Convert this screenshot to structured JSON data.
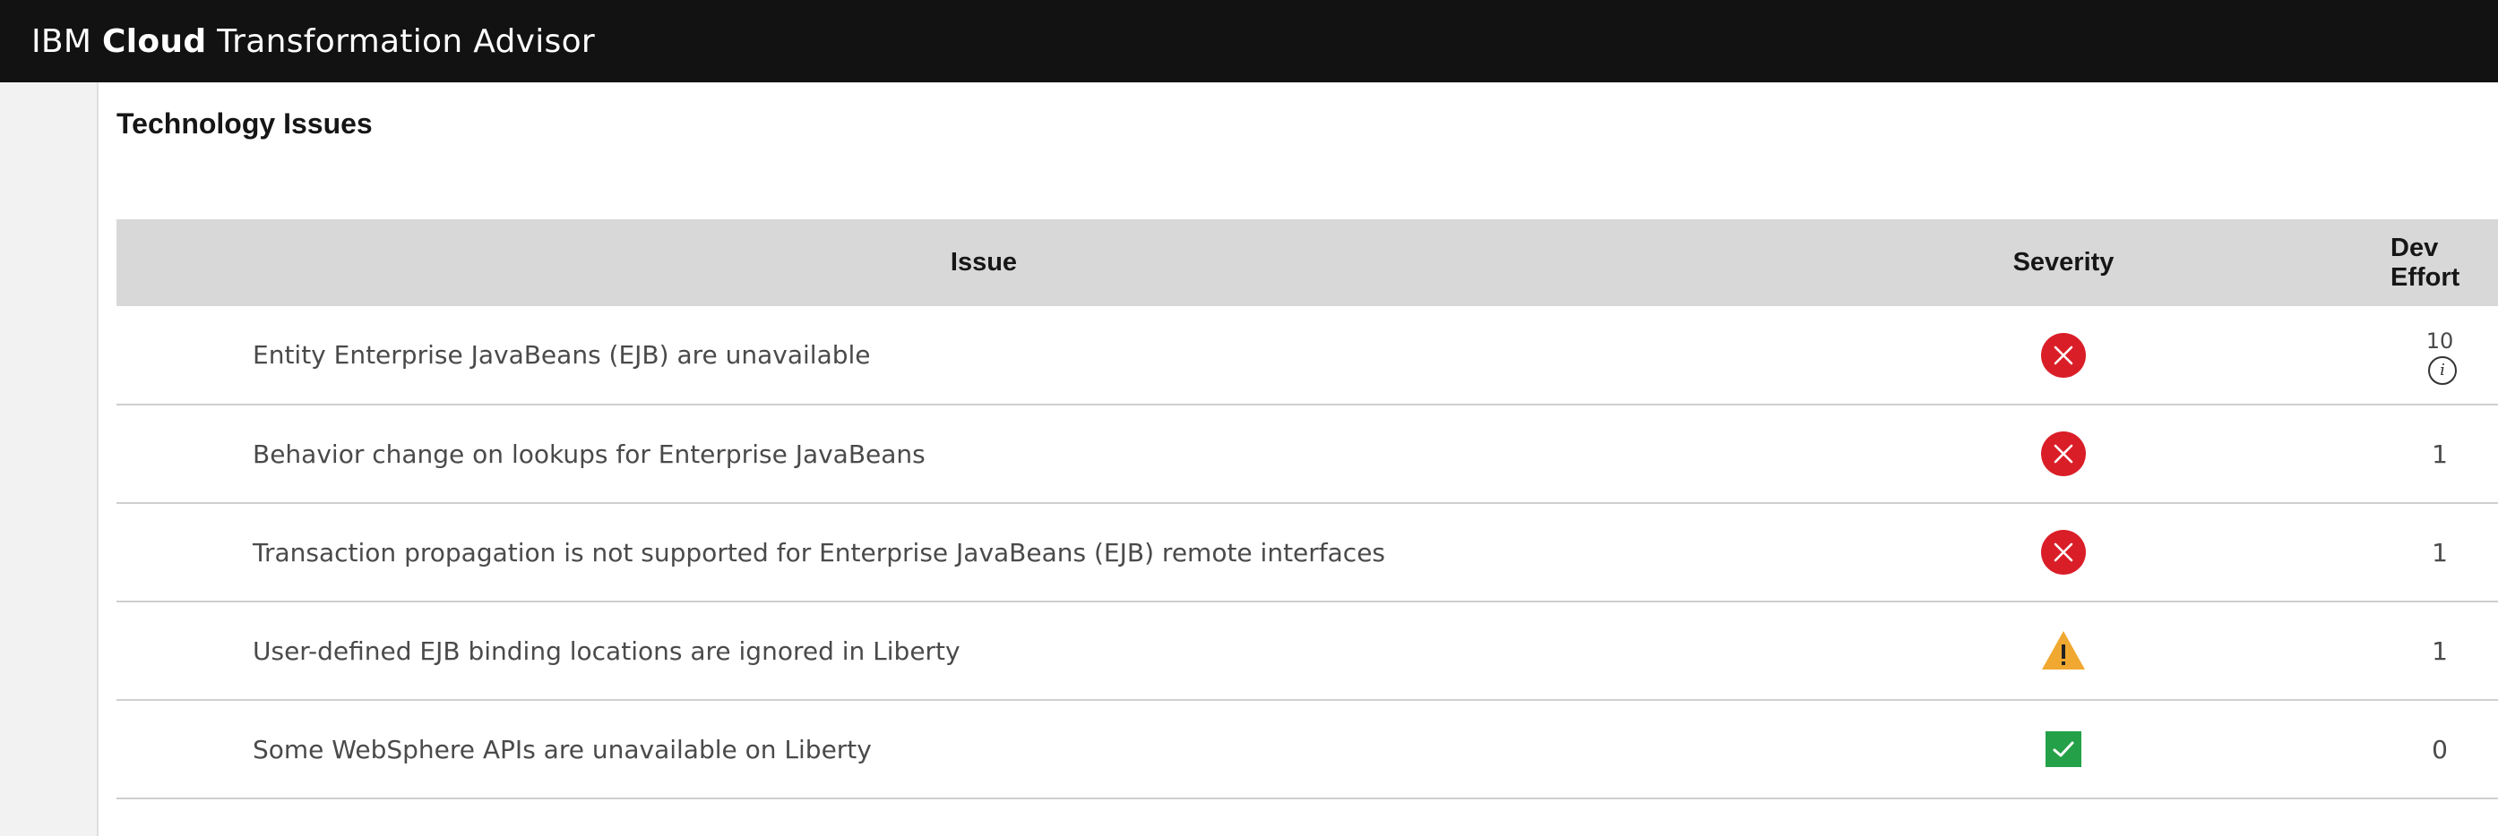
{
  "header": {
    "brand_prefix": "IBM",
    "brand_bold": "Cloud",
    "brand_suffix": "Transformation Advisor"
  },
  "page": {
    "title": "Technology Issues"
  },
  "table": {
    "columns": {
      "issue": "Issue",
      "severity": "Severity",
      "effort": "Dev Effort"
    },
    "rows": [
      {
        "issue": "Entity Enterprise JavaBeans (EJB) are unavailable",
        "severity": "critical",
        "effort": "10",
        "has_info": true
      },
      {
        "issue": "Behavior change on lookups for Enterprise JavaBeans",
        "severity": "critical",
        "effort": "1",
        "has_info": false
      },
      {
        "issue": "Transaction propagation is not supported for Enterprise JavaBeans (EJB) remote interfaces",
        "severity": "critical",
        "effort": "1",
        "has_info": false
      },
      {
        "issue": "User-defined EJB binding locations are ignored in Liberty",
        "severity": "warning",
        "effort": "1",
        "has_info": false
      },
      {
        "issue": "Some WebSphere APIs are unavailable on Liberty",
        "severity": "ok",
        "effort": "0",
        "has_info": false
      }
    ]
  },
  "icons": {
    "critical": "x-circle-icon",
    "warning": "warning-triangle-icon",
    "ok": "checkmark-square-icon",
    "info": "info-circle-icon"
  },
  "colors": {
    "topbar": "#121212",
    "critical": "#da1e28",
    "warning": "#f1c21b",
    "warning_fill": "#f0a830",
    "ok": "#24a148",
    "header_row": "#d8d8d8"
  }
}
